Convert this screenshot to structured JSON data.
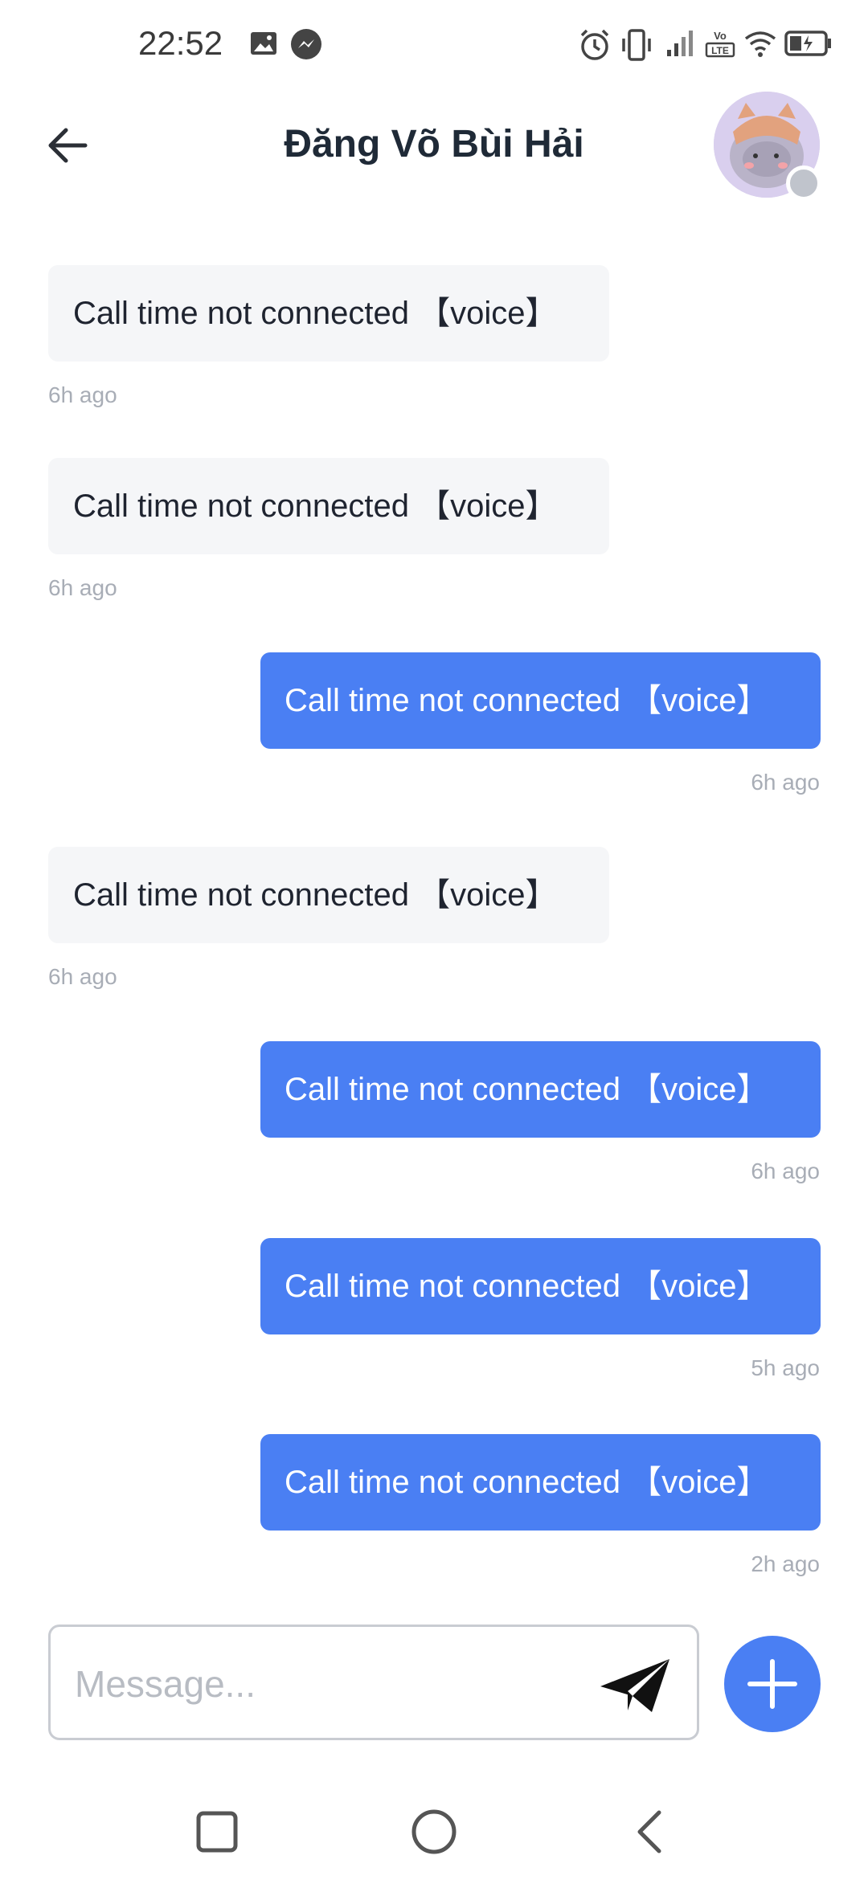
{
  "status_bar": {
    "time": "22:52",
    "icons": [
      "image-icon",
      "messenger-icon",
      "alarm-icon",
      "vibrate-icon",
      "signal-icon",
      "volte-icon",
      "wifi-icon",
      "battery-charging-icon"
    ],
    "volte_label": "Vo LTE"
  },
  "header": {
    "back_icon": "arrow-left-icon",
    "title": "Đăng Võ Bùi Hải",
    "avatar": "avatar",
    "presence": "offline"
  },
  "messages": [
    {
      "direction": "in",
      "text": "Call time not connected 【voice】",
      "time": "6h ago"
    },
    {
      "direction": "in",
      "text": "Call time not connected 【voice】",
      "time": "6h ago"
    },
    {
      "direction": "out",
      "text": "Call time not connected 【voice】",
      "time": "6h ago"
    },
    {
      "direction": "in",
      "text": "Call time not connected 【voice】",
      "time": "6h ago"
    },
    {
      "direction": "out",
      "text": "Call time not connected 【voice】",
      "time": "6h ago"
    },
    {
      "direction": "out",
      "text": "Call time not connected 【voice】",
      "time": "5h ago"
    },
    {
      "direction": "out",
      "text": "Call time not connected 【voice】",
      "time": "2h ago"
    }
  ],
  "composer": {
    "placeholder": "Message...",
    "value": "",
    "send_icon": "send-icon",
    "add_icon": "plus-icon"
  },
  "nav_bar": {
    "icons": [
      "recents-icon",
      "home-icon",
      "back-icon"
    ]
  },
  "colors": {
    "accent": "#4a7ff3",
    "incoming_bubble": "#f5f6f8",
    "timestamp": "#a8adb6"
  }
}
